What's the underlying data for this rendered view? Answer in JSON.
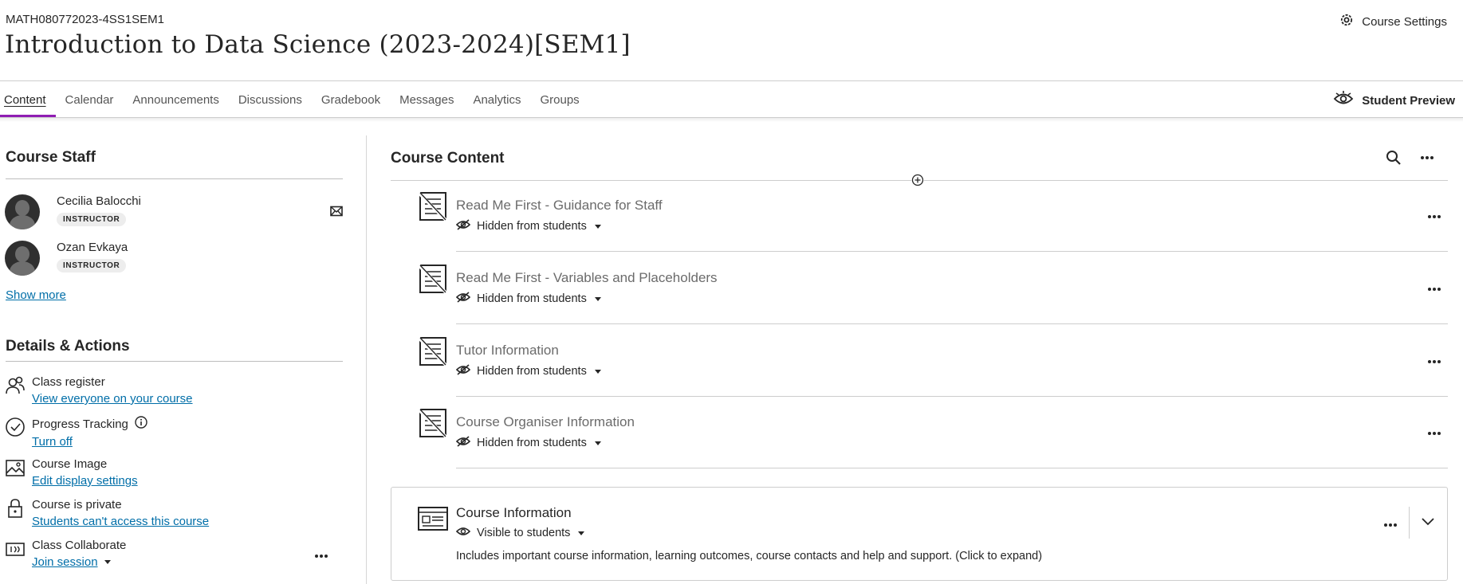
{
  "header": {
    "course_code": "MATH080772023-4SS1SEM1",
    "course_title": "Introduction to Data Science (2023-2024)[SEM1]",
    "settings_label": "Course Settings"
  },
  "tabs": [
    {
      "label": "Content",
      "active": true
    },
    {
      "label": "Calendar"
    },
    {
      "label": "Announcements"
    },
    {
      "label": "Discussions"
    },
    {
      "label": "Gradebook"
    },
    {
      "label": "Messages"
    },
    {
      "label": "Analytics"
    },
    {
      "label": "Groups"
    }
  ],
  "student_preview_label": "Student Preview",
  "staff": {
    "heading": "Course Staff",
    "members": [
      {
        "name": "Cecilia Balocchi",
        "role": "INSTRUCTOR"
      },
      {
        "name": "Ozan Evkaya",
        "role": "INSTRUCTOR"
      }
    ],
    "show_more": "Show more"
  },
  "details": {
    "heading": "Details & Actions",
    "actions": [
      {
        "label": "Class register",
        "link": "View everyone on your course",
        "icon": "people-icon"
      },
      {
        "label": "Progress Tracking",
        "link": "Turn off",
        "icon": "check-circle-icon"
      },
      {
        "label": "Course Image",
        "link": "Edit display settings",
        "icon": "image-icon"
      },
      {
        "label": "Course is private",
        "link": "Students can't access this course",
        "icon": "lock-icon"
      },
      {
        "label": "Class Collaborate",
        "link": "Join session",
        "icon": "collaborate-icon"
      }
    ]
  },
  "content": {
    "heading": "Course Content",
    "items": [
      {
        "title": "Read Me First - Guidance for Staff",
        "visibility": "Hidden from students"
      },
      {
        "title": "Read Me First - Variables and Placeholders",
        "visibility": "Hidden from students"
      },
      {
        "title": "Tutor Information",
        "visibility": "Hidden from students"
      },
      {
        "title": "Course Organiser Information",
        "visibility": "Hidden from students"
      }
    ],
    "folder": {
      "title": "Course Information",
      "visibility": "Visible to students",
      "description": "Includes important course information, learning outcomes, course contacts and help and support. (Click to expand)"
    }
  },
  "colors": {
    "accent": "#8f1db3",
    "link": "#006ea8",
    "text": "#262626"
  }
}
